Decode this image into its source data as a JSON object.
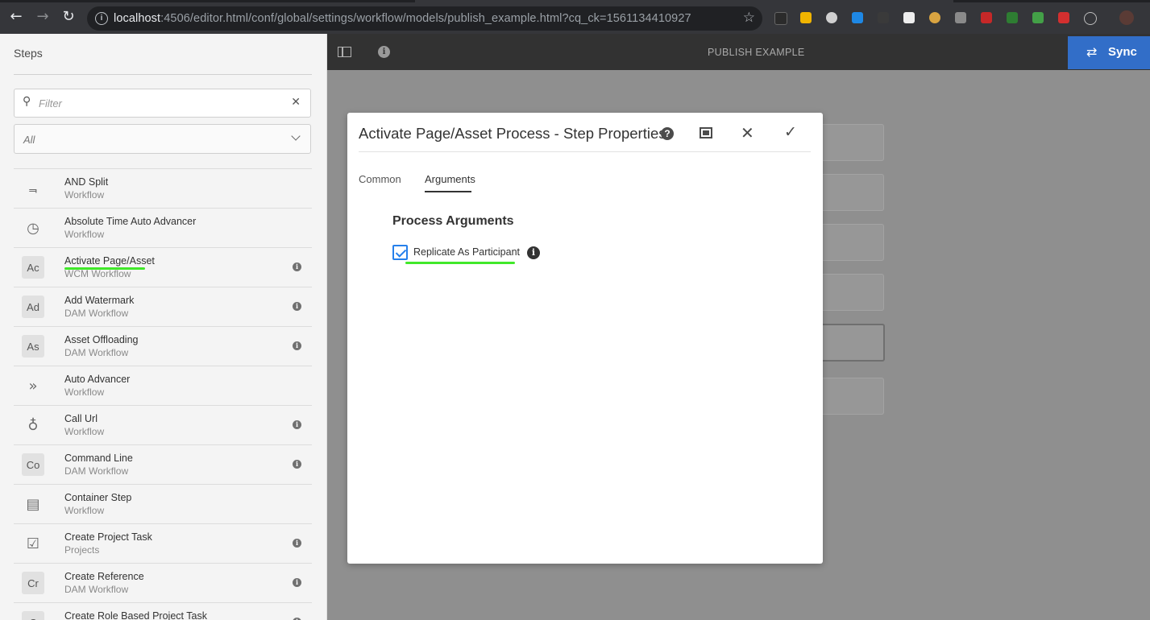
{
  "browser": {
    "url_host": "localhost",
    "url_rest": ":4506/editor.html/conf/global/settings/workflow/models/publish_example.html?cq_ck=1561134410927"
  },
  "editor": {
    "title": "PUBLISH EXAMPLE",
    "sync_label": "Sync"
  },
  "steps_panel": {
    "title": "Steps",
    "filter_placeholder": "Filter",
    "select_value": "All",
    "items": [
      {
        "icon": "split-icon",
        "badge": "",
        "name": "AND Split",
        "category": "Workflow",
        "info": false
      },
      {
        "icon": "clock-icon",
        "badge": "",
        "name": "Absolute Time Auto Advancer",
        "category": "Workflow",
        "info": false
      },
      {
        "icon": "badge",
        "badge": "Ac",
        "name": "Activate Page/Asset",
        "category": "WCM Workflow",
        "info": true
      },
      {
        "icon": "badge",
        "badge": "Ad",
        "name": "Add Watermark",
        "category": "DAM Workflow",
        "info": true
      },
      {
        "icon": "badge",
        "badge": "As",
        "name": "Asset Offloading",
        "category": "DAM Workflow",
        "info": true
      },
      {
        "icon": "double-chevron-icon",
        "badge": "",
        "name": "Auto Advancer",
        "category": "Workflow",
        "info": false
      },
      {
        "icon": "globe-icon",
        "badge": "",
        "name": "Call Url",
        "category": "Workflow",
        "info": true
      },
      {
        "icon": "badge",
        "badge": "Co",
        "name": "Command Line",
        "category": "DAM Workflow",
        "info": true
      },
      {
        "icon": "box-icon",
        "badge": "",
        "name": "Container Step",
        "category": "Workflow",
        "info": false
      },
      {
        "icon": "checklist-icon",
        "badge": "",
        "name": "Create Project Task",
        "category": "Projects",
        "info": true
      },
      {
        "icon": "badge",
        "badge": "Cr",
        "name": "Create Reference",
        "category": "DAM Workflow",
        "info": true
      },
      {
        "icon": "badge",
        "badge": "C",
        "name": "Create Role Based Project Task",
        "category": "",
        "info": true
      }
    ]
  },
  "dialog": {
    "title": "Activate Page/Asset Process - Step Properties",
    "tabs": [
      {
        "label": "Common",
        "active": false
      },
      {
        "label": "Arguments",
        "active": true
      }
    ],
    "section_title": "Process Arguments",
    "checkbox_label": "Replicate As Participant",
    "checkbox_checked": true
  },
  "colors": {
    "accent_blue": "#326ec8",
    "highlight_green": "#41e82a",
    "checkbox_blue": "#2680eb"
  }
}
